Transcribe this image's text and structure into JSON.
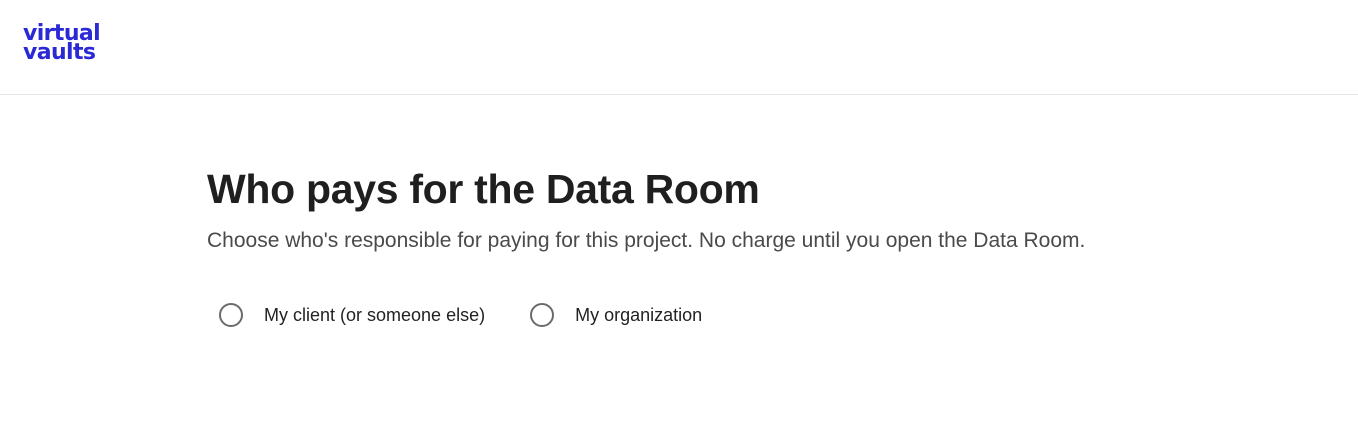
{
  "header": {
    "logo_line1": "virtual",
    "logo_line2": "vaults",
    "brand_color": "#2b28d6"
  },
  "main": {
    "title": "Who pays for the Data Room",
    "subtitle": "Choose who's responsible for paying for this project. No charge until you open the Data Room.",
    "payer_options": [
      {
        "label": "My client (or someone else)",
        "selected": false
      },
      {
        "label": "My organization",
        "selected": false
      }
    ]
  }
}
